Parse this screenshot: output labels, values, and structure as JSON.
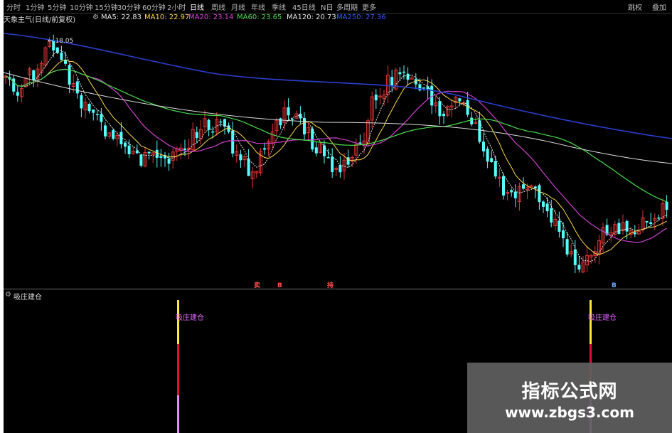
{
  "toolbar": {
    "periods": [
      "分时",
      "1分钟",
      "5分钟",
      "10分钟",
      "15分钟",
      "30分钟",
      "60分钟",
      "2小时",
      "日线",
      "周线",
      "月线",
      "年线",
      "季线",
      "45日线",
      "N日",
      "多周期",
      "更多"
    ],
    "active_index": 8,
    "right": [
      "跳权",
      "叠加"
    ]
  },
  "legend": {
    "title": "天象主气(日线/前复权)",
    "items": [
      {
        "label": "MA5: 22.83",
        "color": "#e8e8e8"
      },
      {
        "label": "MA10: 22.97",
        "color": "#ffd84a"
      },
      {
        "label": "MA20: 23.14",
        "color": "#e040e0"
      },
      {
        "label": "MA60: 23.65",
        "color": "#4ade4a"
      },
      {
        "label": "MA120: 20.73",
        "color": "#e8e8e8"
      },
      {
        "label": "MA250: 27.36",
        "color": "#3a5bff"
      }
    ]
  },
  "price_marker": "18.05",
  "signals": [
    "卖",
    "B",
    "持",
    "B"
  ],
  "sub_panel": {
    "title": "吸庄建仓",
    "signal_label": "吸庄建仓"
  },
  "watermark": {
    "title": "指标公式网",
    "url": "www.zbgs3.com"
  },
  "colors": {
    "up": "#e33333",
    "down": "#54ffff",
    "ma5": "#e8e8e8",
    "ma10": "#ffd84a",
    "ma20": "#d040d0",
    "ma60": "#4ade4a",
    "ma120": "#dcdcdc",
    "ma250": "#2a3fd0",
    "signal_yellow": "#ffe83a",
    "signal_red": "#e01030",
    "signal_pink": "#e48aff"
  }
}
